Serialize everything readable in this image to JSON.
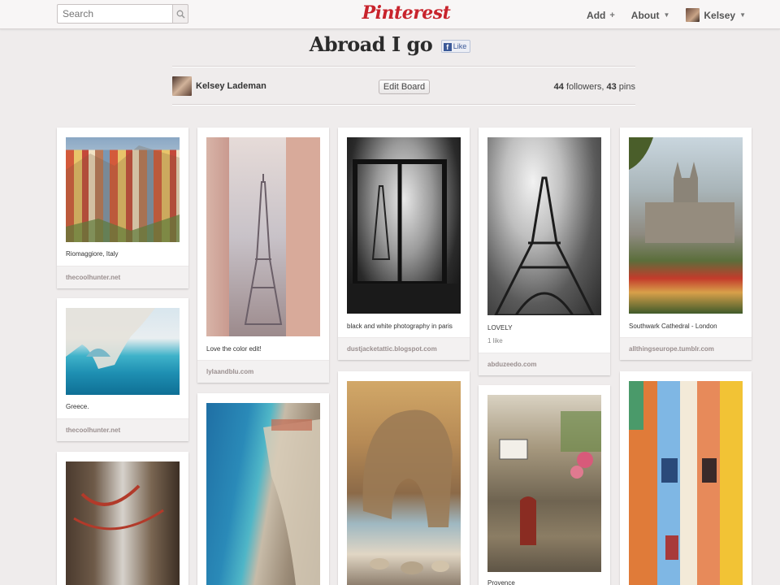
{
  "header": {
    "search_placeholder": "Search",
    "logo": "Pinterest",
    "nav": {
      "add_label": "Add",
      "add_symbol": "+",
      "about_label": "About",
      "user_label": "Kelsey"
    }
  },
  "board": {
    "title": "Abroad I go",
    "like_label": "Like",
    "owner": "Kelsey Lademan",
    "edit_label": "Edit Board",
    "followers": "44",
    "followers_label": " followers, ",
    "pins": "43",
    "pins_label": " pins"
  },
  "pins": [
    {
      "desc": "Riomaggiore, Italy",
      "source": "thecoolhunter.net"
    },
    {
      "desc": "Greece.",
      "source": "thecoolhunter.net"
    },
    {
      "desc": "Love the color edit!",
      "source": "lylaandblu.com"
    },
    {
      "desc": "black and white photography in paris",
      "source": "dustjacketattic.blogspot.com"
    },
    {
      "desc": "LOVELY",
      "likes": "1 like",
      "source": "abduzeedo.com"
    },
    {
      "desc": "Southwark Cathedral - London",
      "source": "allthingseurope.tumblr.com"
    },
    {
      "desc": "Provence"
    }
  ]
}
